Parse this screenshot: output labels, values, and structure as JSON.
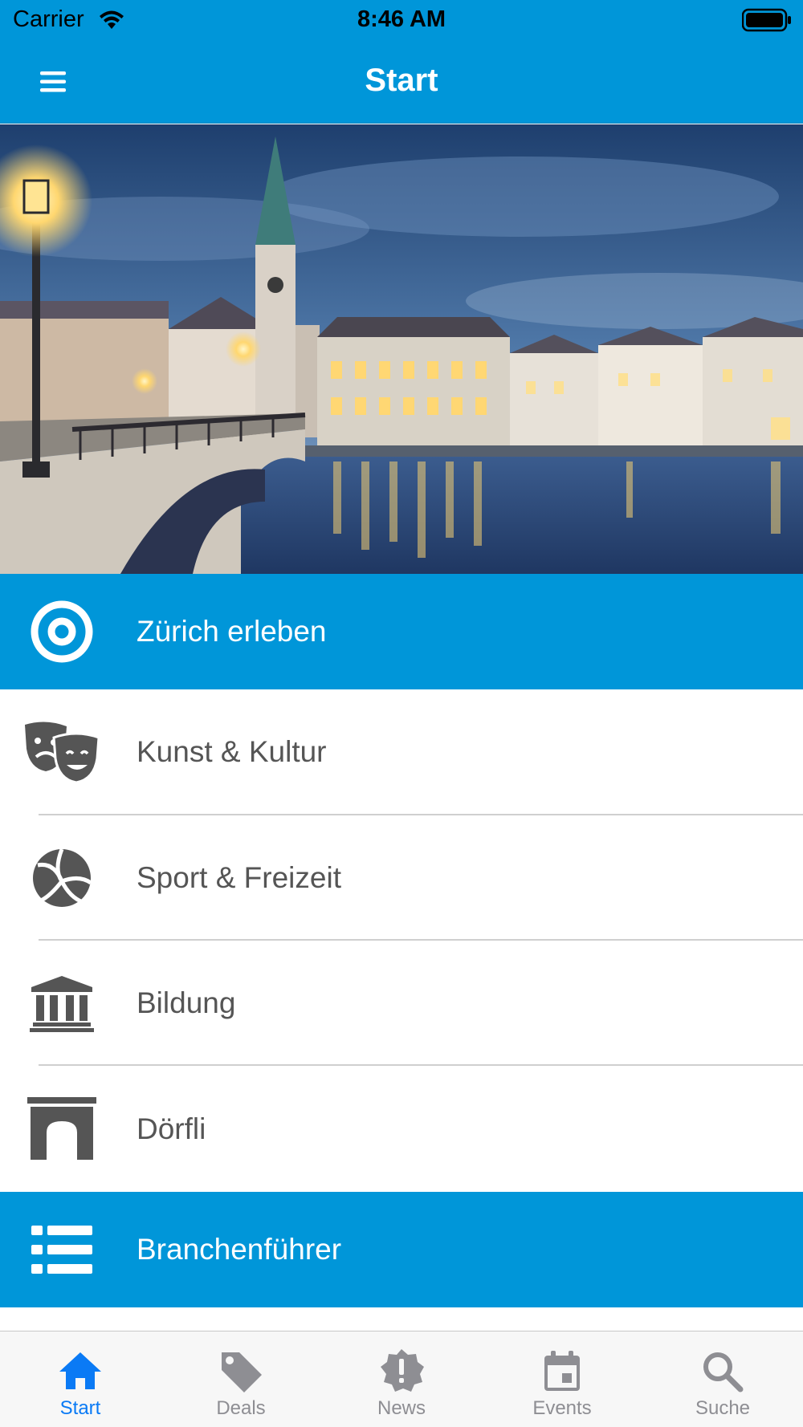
{
  "status_bar": {
    "carrier": "Carrier",
    "time": "8:46 AM",
    "wifi_icon": "wifi-icon",
    "battery_icon": "battery-icon"
  },
  "nav": {
    "title": "Start",
    "menu_icon": "hamburger-menu-icon"
  },
  "colors": {
    "primary": "#0096d9",
    "tab_active": "#0a7af5",
    "tab_inactive": "#8e8e93",
    "icon_gray": "#555555"
  },
  "menu": {
    "items": [
      {
        "label": "Zürich erleben",
        "icon": "target-icon",
        "style": "blue"
      },
      {
        "label": "Kunst & Kultur",
        "icon": "theater-masks-icon",
        "style": "white"
      },
      {
        "label": "Sport & Freizeit",
        "icon": "volleyball-icon",
        "style": "white"
      },
      {
        "label": "Bildung",
        "icon": "institution-icon",
        "style": "white"
      },
      {
        "label": "Dörfli",
        "icon": "archway-icon",
        "style": "white"
      },
      {
        "label": "Branchenführer",
        "icon": "list-icon",
        "style": "blue"
      }
    ]
  },
  "tabs": {
    "active": "Start",
    "items": [
      {
        "label": "Start",
        "icon": "home-icon"
      },
      {
        "label": "Deals",
        "icon": "tag-icon"
      },
      {
        "label": "News",
        "icon": "alert-badge-icon"
      },
      {
        "label": "Events",
        "icon": "calendar-icon"
      },
      {
        "label": "Suche",
        "icon": "search-icon"
      }
    ]
  }
}
